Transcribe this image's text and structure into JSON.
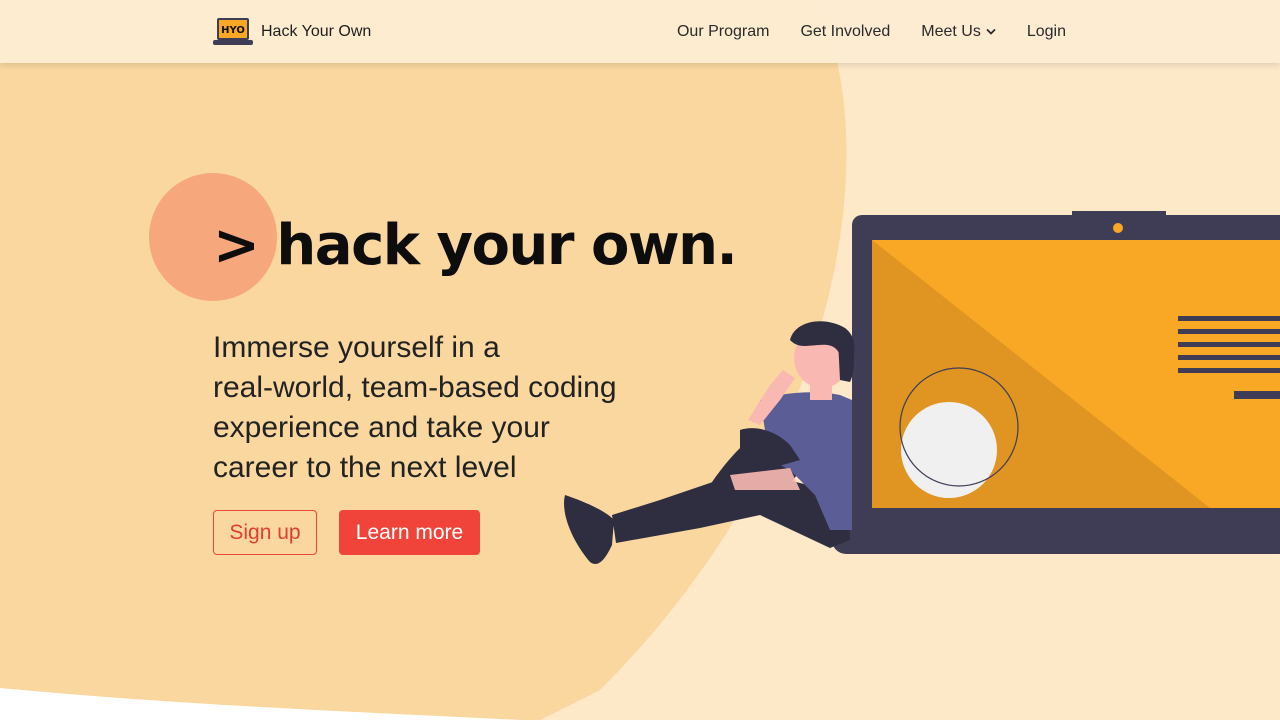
{
  "brand": {
    "name": "Hack Your Own",
    "logo_text": "HYO",
    "logo_icon": "laptop-icon"
  },
  "nav": {
    "items": [
      {
        "label": "Our Program",
        "has_dropdown": false
      },
      {
        "label": "Get Involved",
        "has_dropdown": false
      },
      {
        "label": "Meet Us",
        "has_dropdown": true
      },
      {
        "label": "Login",
        "has_dropdown": false
      }
    ]
  },
  "hero": {
    "title": "> hack your own.",
    "subtitle_lines": [
      "Immerse yourself in a",
      "real-world, team-based coding",
      "experience and take your",
      "career to the next level"
    ],
    "primary_button": "Sign up",
    "secondary_button": "Learn more"
  },
  "colors": {
    "background": "#fde8c8",
    "blob": "#f9d79f",
    "accent_circle": "#f7a77c",
    "button_red": "#f0443a",
    "laptop_dark": "#3f3d56",
    "laptop_screen": "#f9a825"
  }
}
